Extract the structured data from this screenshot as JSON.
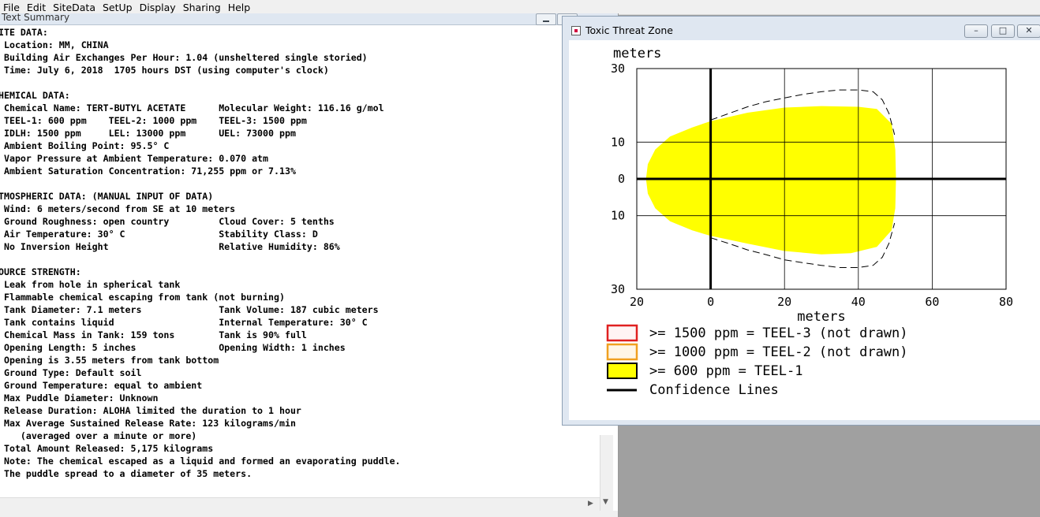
{
  "menu": [
    "File",
    "Edit",
    "SiteData",
    "SetUp",
    "Display",
    "Sharing",
    "Help"
  ],
  "text_summary": {
    "title": "Text Summary",
    "lines": [
      "ITE DATA:",
      " Location: MM, CHINA",
      " Building Air Exchanges Per Hour: 1.04 (unsheltered single storied)",
      " Time: July 6, 2018  1705 hours DST (using computer's clock)",
      "",
      "HEMICAL DATA:",
      " Chemical Name: TERT-BUTYL ACETATE      Molecular Weight: 116.16 g/mol",
      " TEEL-1: 600 ppm    TEEL-2: 1000 ppm    TEEL-3: 1500 ppm",
      " IDLH: 1500 ppm     LEL: 13000 ppm      UEL: 73000 ppm",
      " Ambient Boiling Point: 95.5° C",
      " Vapor Pressure at Ambient Temperature: 0.070 atm",
      " Ambient Saturation Concentration: 71,255 ppm or 7.13%",
      "",
      "TMOSPHERIC DATA: (MANUAL INPUT OF DATA)",
      " Wind: 6 meters/second from SE at 10 meters",
      " Ground Roughness: open country         Cloud Cover: 5 tenths",
      " Air Temperature: 30° C                 Stability Class: D",
      " No Inversion Height                    Relative Humidity: 86%",
      "",
      "OURCE STRENGTH:",
      " Leak from hole in spherical tank",
      " Flammable chemical escaping from tank (not burning)",
      " Tank Diameter: 7.1 meters              Tank Volume: 187 cubic meters",
      " Tank contains liquid                   Internal Temperature: 30° C",
      " Chemical Mass in Tank: 159 tons        Tank is 90% full",
      " Opening Length: 5 inches               Opening Width: 1 inches",
      " Opening is 3.55 meters from tank bottom",
      " Ground Type: Default soil",
      " Ground Temperature: equal to ambient",
      " Max Puddle Diameter: Unknown",
      " Release Duration: ALOHA limited the duration to 1 hour",
      " Max Average Sustained Release Rate: 123 kilograms/min",
      "    (averaged over a minute or more)",
      " Total Amount Released: 5,175 kilograms",
      " Note: The chemical escaped as a liquid and formed an evaporating puddle.",
      " The puddle spread to a diameter of 35 meters."
    ]
  },
  "threat_zone": {
    "title": "Toxic Threat Zone",
    "controls": {
      "minimize": "–",
      "maximize": "□",
      "close": "✕"
    },
    "colors": {
      "teel1_fill": "#ffff00",
      "teel2_border": "#f0a020",
      "teel3_border": "#e02020",
      "confidence_line": "#000000"
    },
    "legend": [
      {
        "text": ">= 1500 ppm = TEEL-3 (not drawn)",
        "swatch": "teel3"
      },
      {
        "text": ">= 1000 ppm = TEEL-2 (not drawn)",
        "swatch": "teel2"
      },
      {
        "text": ">= 600 ppm = TEEL-1",
        "swatch": "teel1"
      },
      {
        "text": "Confidence Lines",
        "swatch": "line"
      }
    ]
  },
  "chart_data": {
    "type": "area",
    "title": "",
    "xlabel": "meters",
    "ylabel": "meters",
    "xlim": [
      -20,
      80
    ],
    "ylim": [
      -30,
      30
    ],
    "x_ticks": [
      {
        "value": -20,
        "label": "20"
      },
      {
        "value": 0,
        "label": "0"
      },
      {
        "value": 20,
        "label": "20"
      },
      {
        "value": 40,
        "label": "40"
      },
      {
        "value": 60,
        "label": "60"
      },
      {
        "value": 80,
        "label": "80"
      }
    ],
    "y_ticks": [
      {
        "value": 30,
        "label": "30"
      },
      {
        "value": 10,
        "label": "10"
      },
      {
        "value": 0,
        "label": "0"
      },
      {
        "value": -10,
        "label": "10"
      },
      {
        "value": -30,
        "label": "30"
      }
    ],
    "grid": true,
    "series": [
      {
        "name": ">= 600 ppm = TEEL-1",
        "kind": "filled_zone",
        "points": [
          [
            -17.5,
            0
          ],
          [
            -17,
            4
          ],
          [
            -15,
            8
          ],
          [
            -11,
            11.5
          ],
          [
            -5,
            14
          ],
          [
            0,
            15.7
          ],
          [
            10,
            18
          ],
          [
            20,
            19.4
          ],
          [
            30,
            19.8
          ],
          [
            40,
            19.6
          ],
          [
            45,
            19
          ],
          [
            49,
            15
          ],
          [
            50,
            8
          ],
          [
            50.2,
            0
          ],
          [
            50,
            -8
          ],
          [
            49,
            -14
          ],
          [
            45,
            -18.5
          ],
          [
            38,
            -20.2
          ],
          [
            30,
            -20.5
          ],
          [
            20,
            -19.6
          ],
          [
            10,
            -17.6
          ],
          [
            0,
            -15.5
          ],
          [
            -5,
            -14
          ],
          [
            -11,
            -11.5
          ],
          [
            -15,
            -8
          ],
          [
            -17,
            -4
          ]
        ]
      },
      {
        "name": "Confidence Lines",
        "kind": "dashed_upper",
        "points": [
          [
            0,
            16
          ],
          [
            5,
            17.8
          ],
          [
            10,
            19.6
          ],
          [
            15,
            21
          ],
          [
            20,
            22
          ],
          [
            25,
            23
          ],
          [
            30,
            23.7
          ],
          [
            35,
            24.2
          ],
          [
            40,
            24.2
          ],
          [
            44,
            23.7
          ],
          [
            46.5,
            21.5
          ],
          [
            48.3,
            17.8
          ],
          [
            49.8,
            12
          ]
        ]
      },
      {
        "name": "Confidence Lines",
        "kind": "dashed_lower",
        "points": [
          [
            0,
            -16
          ],
          [
            5,
            -17.6
          ],
          [
            10,
            -19.3
          ],
          [
            15,
            -20.6
          ],
          [
            20,
            -22
          ],
          [
            25,
            -22.8
          ],
          [
            30,
            -23.5
          ],
          [
            35,
            -24.1
          ],
          [
            40,
            -24.1
          ],
          [
            44,
            -23.5
          ],
          [
            46.5,
            -21.3
          ],
          [
            48.3,
            -17.5
          ],
          [
            49.8,
            -12
          ]
        ]
      }
    ]
  }
}
